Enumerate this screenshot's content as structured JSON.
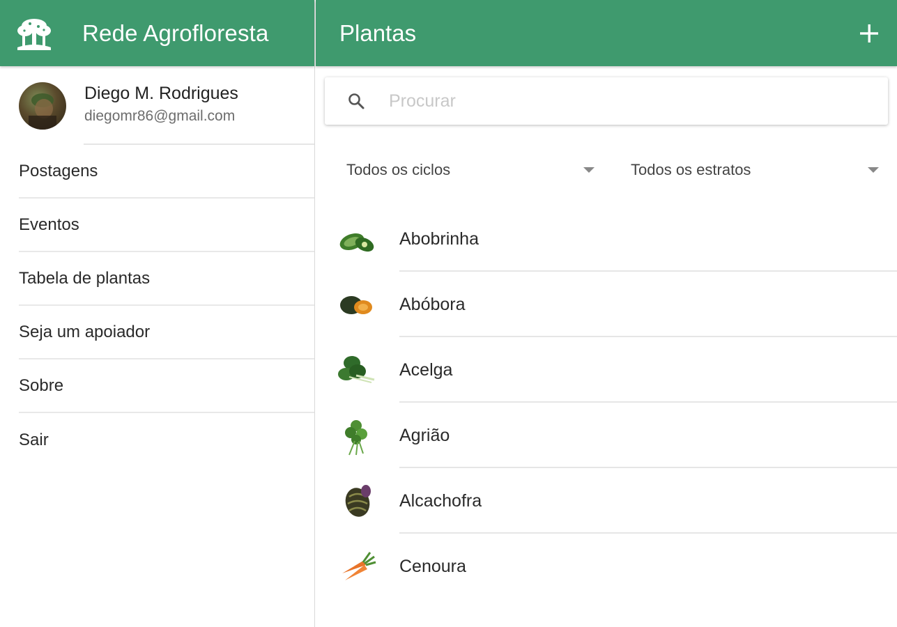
{
  "sidebar": {
    "app_title": "Rede Agrofloresta",
    "profile": {
      "name": "Diego M. Rodrigues",
      "email": "diegomr86@gmail.com"
    },
    "menu": [
      {
        "label": "Postagens"
      },
      {
        "label": "Eventos"
      },
      {
        "label": "Tabela de plantas"
      },
      {
        "label": "Seja um apoiador"
      },
      {
        "label": "Sobre"
      },
      {
        "label": "Sair"
      }
    ]
  },
  "main": {
    "title": "Plantas",
    "add_icon": "plus-icon",
    "search": {
      "placeholder": "Procurar",
      "value": "",
      "icon": "search-icon"
    },
    "filters": {
      "cycle": {
        "selected": "Todos os ciclos"
      },
      "stratum": {
        "selected": "Todos os estratos"
      }
    },
    "plants": [
      {
        "name": "Abobrinha",
        "icon": "zucchini-icon"
      },
      {
        "name": "Abóbora",
        "icon": "pumpkin-icon"
      },
      {
        "name": "Acelga",
        "icon": "chard-icon"
      },
      {
        "name": "Agrião",
        "icon": "watercress-icon"
      },
      {
        "name": "Alcachofra",
        "icon": "artichoke-icon"
      },
      {
        "name": "Cenoura",
        "icon": "carrot-icon"
      }
    ]
  },
  "colors": {
    "primary": "#3f9a6e",
    "header_text": "#ffffff",
    "divider": "#e6e6e6"
  }
}
